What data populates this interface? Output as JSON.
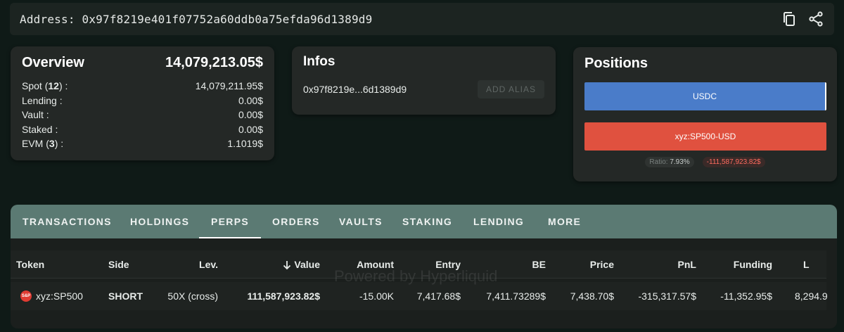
{
  "address": {
    "label": "Address: 0x97f8219e401f07752a60ddb0a75efda96d1389d9"
  },
  "overview": {
    "title": "Overview",
    "total": "14,079,213.05$",
    "rows": [
      {
        "label": "Spot",
        "count": "12",
        "value": "14,079,211.95$"
      },
      {
        "label": "Lending :",
        "value": "0.00$"
      },
      {
        "label": "Vault :",
        "value": "0.00$"
      },
      {
        "label": "Staked :",
        "value": "0.00$"
      },
      {
        "label": "EVM",
        "count": "3",
        "value": "1.1019$"
      }
    ]
  },
  "infos": {
    "title": "Infos",
    "short_address": "0x97f8219e...6d1389d9",
    "add_alias": "ADD ALIAS"
  },
  "positions": {
    "title": "Positions",
    "bars": [
      {
        "label": "USDC",
        "color": "#4a7cc9"
      },
      {
        "label": "xyz:SP500-USD",
        "color": "#e0513f"
      }
    ],
    "ratio_label": "Ratio:",
    "ratio_value": "7.93%",
    "pnl": "-111,587,923.82$"
  },
  "tabs": [
    "TRANSACTIONS",
    "HOLDINGS",
    "PERPS",
    "ORDERS",
    "VAULTS",
    "STAKING",
    "LENDING",
    "MORE"
  ],
  "active_tab": "PERPS",
  "table": {
    "headers": {
      "token": "Token",
      "side": "Side",
      "lev": "Lev.",
      "value": "Value",
      "amount": "Amount",
      "entry": "Entry",
      "be": "BE",
      "price": "Price",
      "pnl": "PnL",
      "funding": "Funding",
      "extra": "L"
    },
    "rows": [
      {
        "icon": "S&P",
        "token": "xyz:SP500",
        "side": "SHORT",
        "lev": "50X (cross)",
        "value": "111,587,923.82$",
        "amount": "-15.00K",
        "entry": "7,417.68$",
        "be": "7,411.73289$",
        "price": "7,438.70$",
        "pnl": "-315,317.57$",
        "funding": "-11,352.95$",
        "extra": "8,294.9"
      }
    ]
  },
  "watermark": "Powered by Hyperliquid",
  "colors": {
    "background": "#0f1a17",
    "tab_bar": "#5b7a73",
    "short": "#ff4a3d",
    "negative": "#ff5a4e"
  }
}
